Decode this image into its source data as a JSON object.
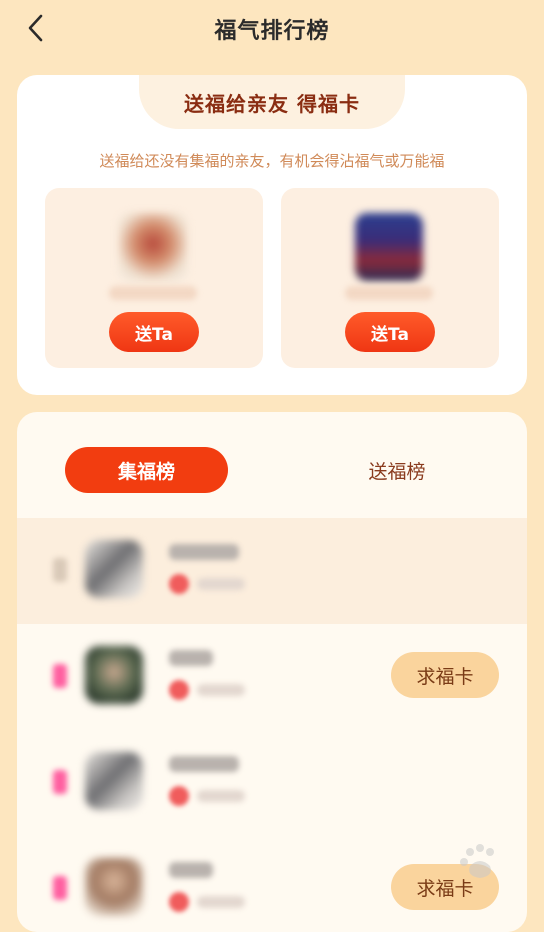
{
  "header": {
    "title": "福气排行榜"
  },
  "send_section": {
    "heading": "送福给亲友 得福卡",
    "description": "送福给还没有集福的亲友，有机会得沾福气或万能福",
    "friends": [
      {
        "button_label": "送Ta"
      },
      {
        "button_label": "送Ta"
      }
    ]
  },
  "rank_section": {
    "tabs": [
      {
        "label": "集福榜",
        "active": true
      },
      {
        "label": "送福榜",
        "active": false
      }
    ],
    "rows": [
      {
        "button_label": ""
      },
      {
        "button_label": "求福卡"
      },
      {
        "button_label": ""
      },
      {
        "button_label": "求福卡"
      }
    ]
  },
  "colors": {
    "background": "#fde6bf",
    "accent": "#f23d10",
    "ask_button": "#fad49d"
  }
}
